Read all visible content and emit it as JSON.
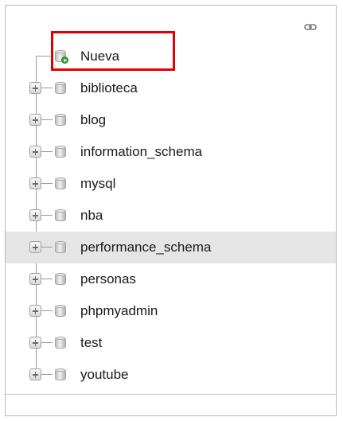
{
  "panel": {
    "link_icon": "chain-link-icon"
  },
  "tree": {
    "new_item": {
      "label": "Nueva",
      "icon": "database-add-icon",
      "highlight_color": "#e00000"
    },
    "databases": [
      {
        "label": "biblioteca",
        "icon": "database-icon"
      },
      {
        "label": "blog",
        "icon": "database-icon"
      },
      {
        "label": "information_schema",
        "icon": "database-icon"
      },
      {
        "label": "mysql",
        "icon": "database-icon"
      },
      {
        "label": "nba",
        "icon": "database-icon"
      },
      {
        "label": "performance_schema",
        "icon": "database-icon",
        "hovered": true
      },
      {
        "label": "personas",
        "icon": "database-icon"
      },
      {
        "label": "phpmyadmin",
        "icon": "database-icon"
      },
      {
        "label": "test",
        "icon": "database-icon"
      },
      {
        "label": "youtube",
        "icon": "database-icon"
      }
    ]
  }
}
